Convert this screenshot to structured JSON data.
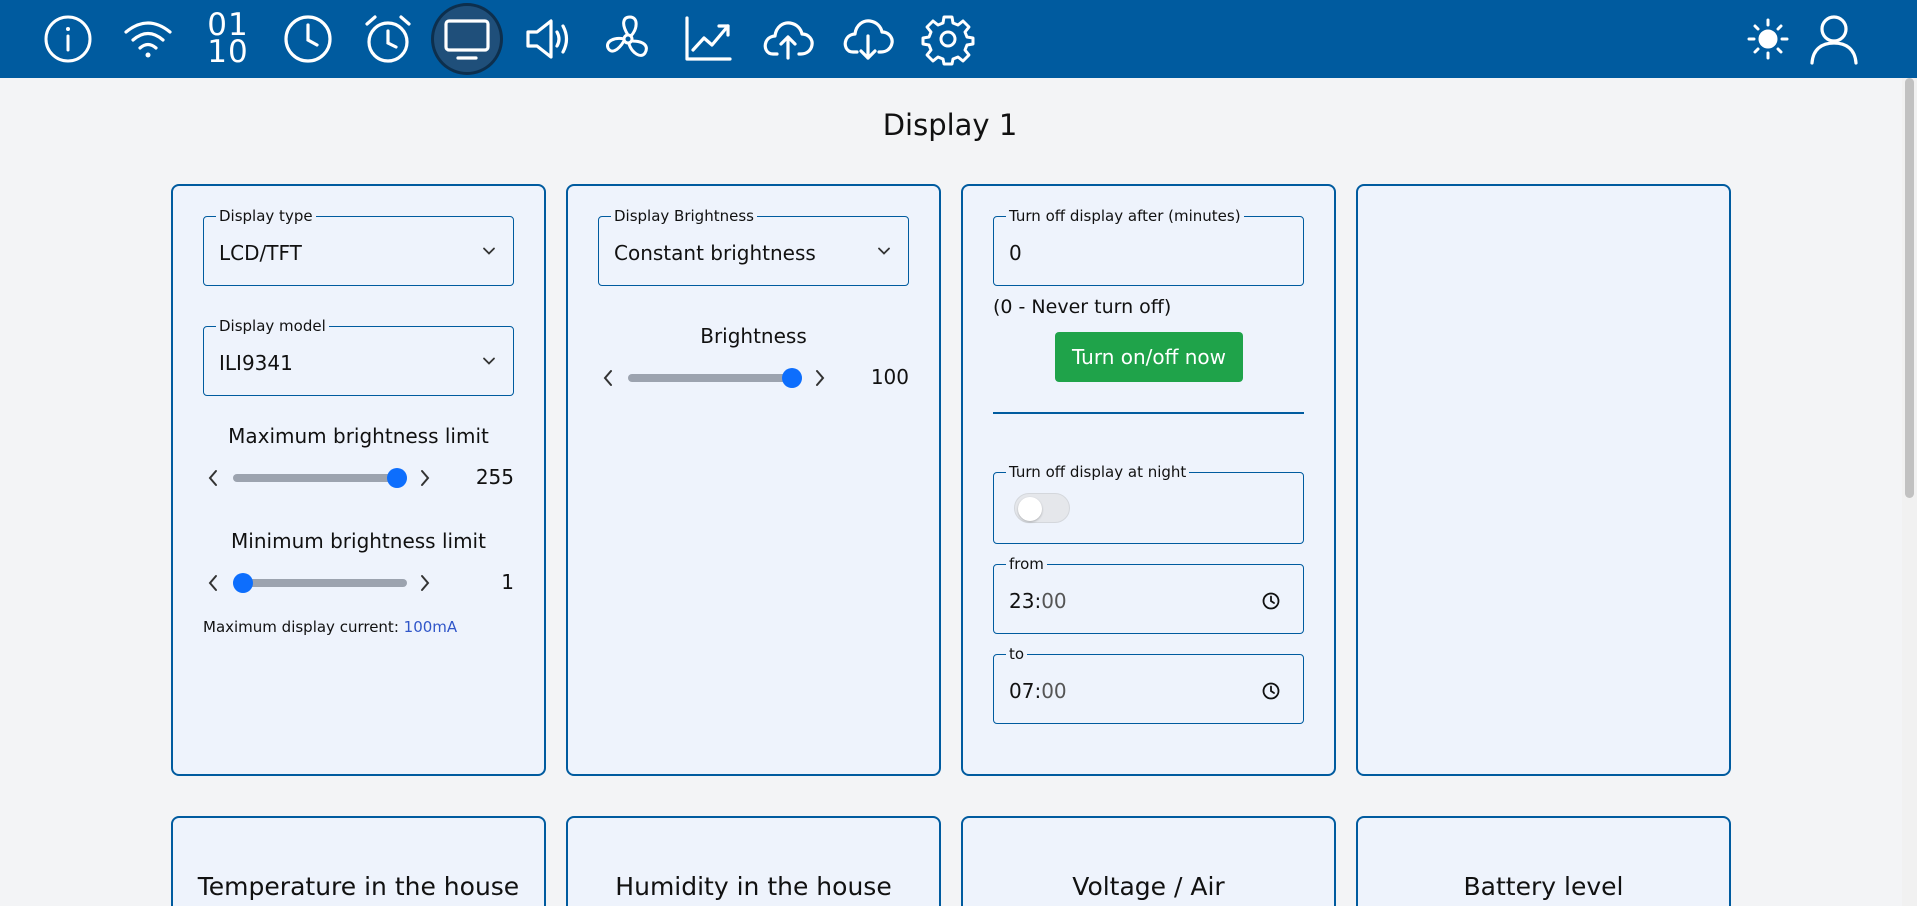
{
  "nav": {
    "icons": [
      {
        "name": "info-icon"
      },
      {
        "name": "wifi-icon"
      },
      {
        "name": "binary-icon",
        "text": "01\n10"
      },
      {
        "name": "clock-icon"
      },
      {
        "name": "alarm-clock-icon"
      },
      {
        "name": "monitor-icon",
        "active": true
      },
      {
        "name": "speaker-icon"
      },
      {
        "name": "fan-icon"
      },
      {
        "name": "chart-line-icon"
      },
      {
        "name": "cloud-upload-icon"
      },
      {
        "name": "cloud-download-icon"
      },
      {
        "name": "gear-icon"
      }
    ],
    "right_icons": [
      "sun-icon",
      "user-icon"
    ],
    "binary_top": "01",
    "binary_bottom": "10"
  },
  "page": {
    "title": "Display 1"
  },
  "card1": {
    "display_type": {
      "legend": "Display type",
      "value": "LCD/TFT"
    },
    "display_model": {
      "legend": "Display model",
      "value": "ILI9341"
    },
    "max_brightness": {
      "label": "Maximum brightness limit",
      "value": "255",
      "min": 0,
      "max": 255,
      "level": 1.0
    },
    "min_brightness": {
      "label": "Minimum brightness limit",
      "value": "1",
      "min": 1,
      "max": 255,
      "level": 0.0
    },
    "current": {
      "label": "Maximum display current:",
      "value": "100mA"
    }
  },
  "card2": {
    "brightness_mode": {
      "legend": "Display Brightness",
      "value": "Constant brightness"
    },
    "brightness": {
      "label": "Brightness",
      "value": "100",
      "level": 1.0
    }
  },
  "card3": {
    "turn_off_after": {
      "legend": "Turn off display after (minutes)",
      "value": "0"
    },
    "hint": "(0 - Never turn off)",
    "button": "Turn on/off now",
    "night": {
      "legend": "Turn off display at night",
      "enabled": false
    },
    "from": {
      "legend": "from",
      "hours": "23:",
      "minutes": "00"
    },
    "to": {
      "legend": "to",
      "hours": "07:",
      "minutes": "00"
    }
  },
  "bottom_cards": [
    "Temperature in the house",
    "Humidity in the house",
    "Voltage / Air",
    "Battery level"
  ],
  "colors": {
    "topbar": "#005b9f",
    "accent": "#0d6efd",
    "button": "#1fa34a",
    "card_border": "#005b9f"
  }
}
